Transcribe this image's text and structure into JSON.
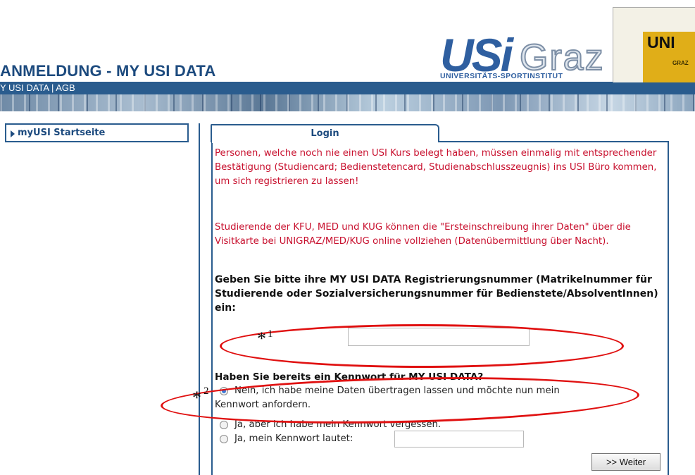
{
  "header": {
    "title": "ANMELDUNG - MY USI DATA",
    "nav_link": "Y USI DATA | AGB"
  },
  "logo": {
    "usi": "USi",
    "graz": "Graz",
    "subtitle": "UNIVERSITÄTS-SPORTINSTITUT",
    "uni": "UNI",
    "uni_sub": "GRAZ"
  },
  "sidebar": {
    "items": [
      {
        "label": "myUSI Startseite"
      }
    ]
  },
  "login": {
    "tab_label": "Login",
    "info_1": "Personen, welche noch nie einen USI Kurs belegt haben, müssen einmalig mit entsprechender Bestätigung (Studiencard; Bedienstetencard, Studienabschlusszeugnis) ins USI Büro kommen, um sich registrieren zu lassen!",
    "info_2": "Studierende der KFU, MED und KUG können die \"Ersteinschreibung ihrer Daten\" über die Visitkarte bei UNIGRAZ/MED/KUG online vollziehen (Datenübermittlung über Nacht).",
    "question_reg": "Geben Sie bitte ihre MY USI DATA Registrierungsnummer (Matrikelnummer für Studierende oder Sozialversicherungsnummer für Bedienstete/AbsolventInnen) ein:",
    "reg_value": "",
    "question_pw": "Haben Sie bereits ein Kennwort für MY USI DATA?",
    "options": [
      {
        "label_line1": "Nein, ich habe meine Daten übertragen lassen und möchte nun mein",
        "label_line2": "Kennwort anfordern.",
        "selected": true
      },
      {
        "label_line1": "Ja, aber ich habe mein Kennwort vergessen.",
        "selected": false
      },
      {
        "label_line1": "Ja, mein Kennwort lautet:",
        "selected": false
      }
    ],
    "password_value": "",
    "next_button": ">> Weiter"
  },
  "annotations": {
    "mark_1": "*",
    "mark_1_num": "1",
    "mark_2": "*",
    "mark_2_num": "2",
    "color": "#e01010"
  }
}
